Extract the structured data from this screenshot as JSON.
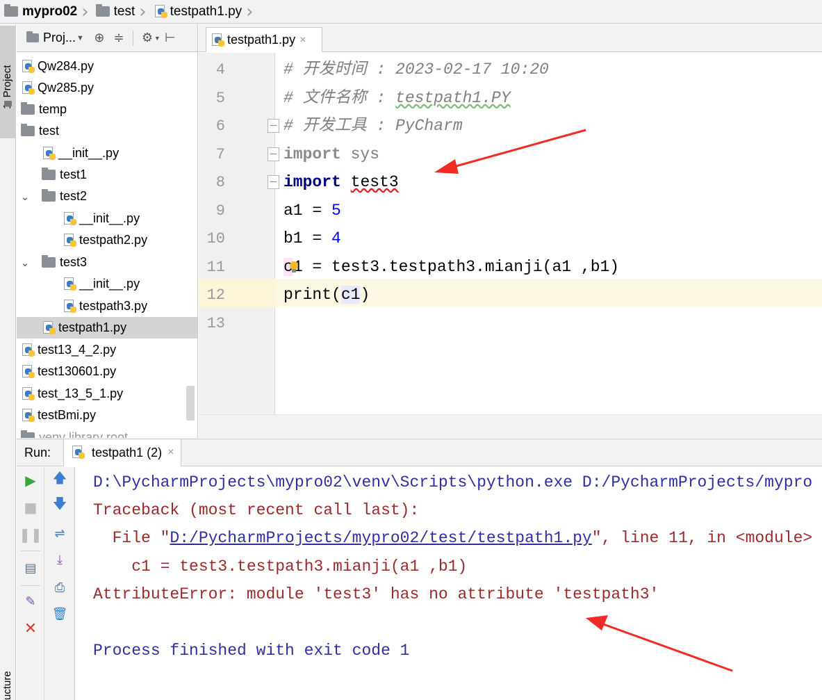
{
  "breadcrumb": {
    "project": "mypro02",
    "folder": "test",
    "file": "testpath1.py"
  },
  "left_strip": {
    "project_tab": "1: Project",
    "structure_tab": "ucture"
  },
  "project_panel": {
    "title": "Proj..."
  },
  "tree": {
    "items": [
      {
        "label": "Qw284.py"
      },
      {
        "label": "Qw285.py"
      },
      {
        "label": "temp"
      },
      {
        "label": "test"
      },
      {
        "label": "__init__.py"
      },
      {
        "label": "test1"
      },
      {
        "label": "test2"
      },
      {
        "label": "__init__.py"
      },
      {
        "label": "testpath2.py"
      },
      {
        "label": "test3"
      },
      {
        "label": "__init__.py"
      },
      {
        "label": "testpath3.py"
      },
      {
        "label": "testpath1.py"
      },
      {
        "label": "test13_4_2.py"
      },
      {
        "label": "test130601.py"
      },
      {
        "label": "test_13_5_1.py"
      },
      {
        "label": "testBmi.py"
      },
      {
        "label": "venv library root"
      }
    ]
  },
  "editor": {
    "tab_label": "testpath1.py",
    "line_numbers": [
      "4",
      "5",
      "6",
      "7",
      "8",
      "9",
      "10",
      "11",
      "12",
      "13"
    ],
    "code": {
      "l4": "# 开发时间 : 2023-02-17 10:20",
      "l5_prefix": "# 文件名称 : ",
      "l5_file": "testpath1.PY",
      "l6": "# 开发工具 : PyCharm",
      "l7_kw": "import",
      "l7_mod": " sys",
      "l8_kw": "import",
      "l8_mod": "test3",
      "l9_var": "a1 = ",
      "l9_num": "5",
      "l10_var": "b1 = ",
      "l10_num": "4",
      "l11_c": "c",
      "l11_one": "1",
      "l11_rest": " = test3.testpath3.mianji(a1 ,b1)",
      "l12_fn": "print(",
      "l12_arg": "c1",
      "l12_close": ")"
    }
  },
  "run": {
    "label": "Run:",
    "tab_label": "testpath1 (2)",
    "output": {
      "line1": "D:\\PycharmProjects\\mypro02\\venv\\Scripts\\python.exe D:/PycharmProjects/mypro",
      "line2": "Traceback (most recent call last):",
      "line3_prefix": "  File \"",
      "line3_link": "D:/PycharmProjects/mypro02/test/testpath1.py",
      "line3_suffix": "\", line 11, in <module>",
      "line4": "    c1 = test3.testpath3.mianji(a1 ,b1)",
      "line5": "AttributeError: module 'test3' has no attribute 'testpath3'",
      "line6": "Process finished with exit code 1"
    }
  },
  "colors": {
    "arrow": "#f02c24",
    "keyword": "#000080",
    "number": "#0000ff",
    "comment": "#808080",
    "error_text": "#9c2a2a",
    "console_blue": "#2f2fa0"
  }
}
